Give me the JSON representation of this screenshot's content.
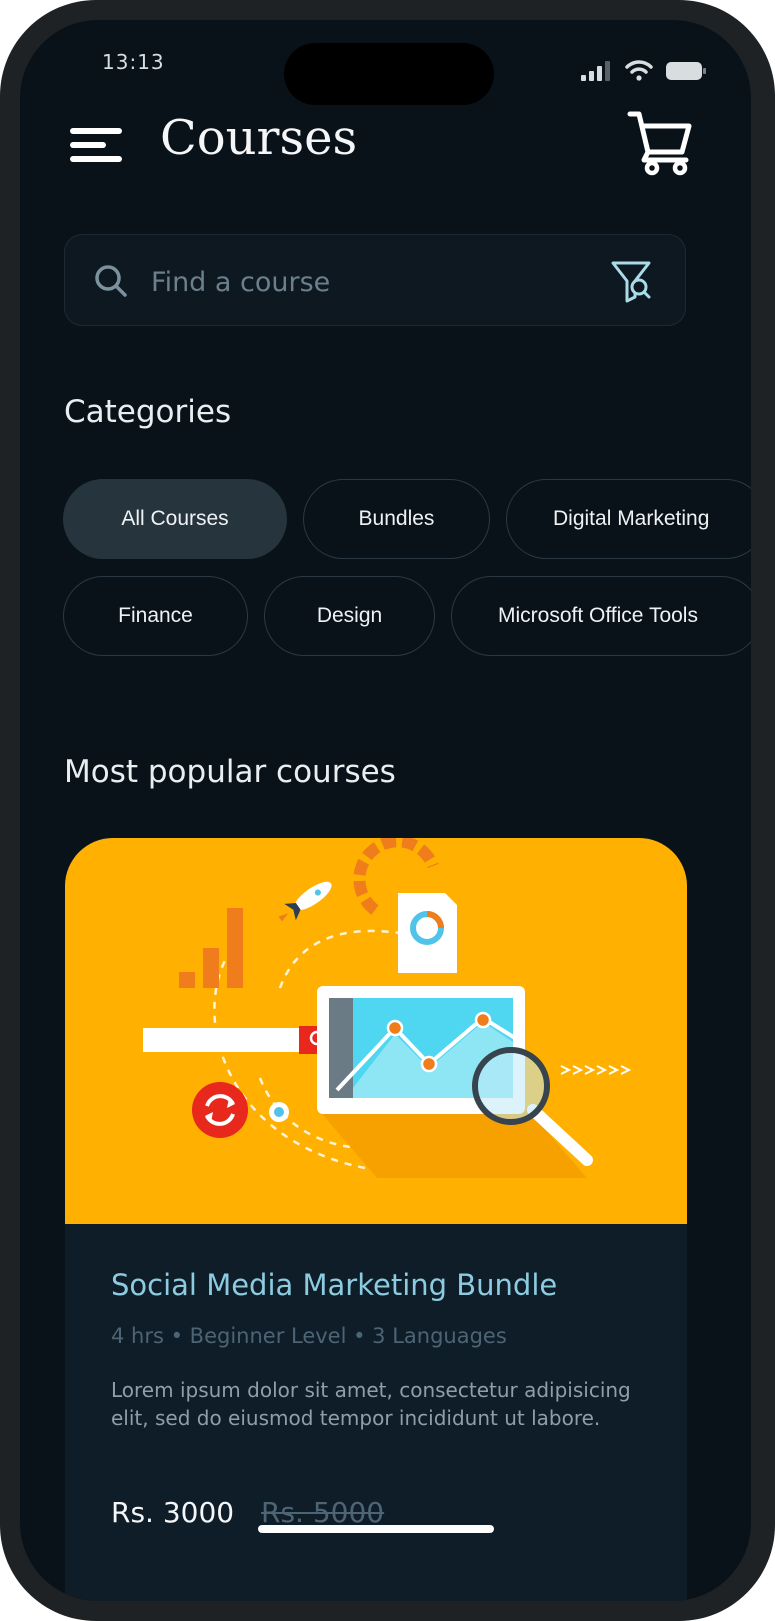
{
  "status_bar": {
    "time": "13:13"
  },
  "header": {
    "title": "Courses"
  },
  "search": {
    "placeholder": "Find a course",
    "value": ""
  },
  "categories": {
    "heading": "Categories",
    "chips": [
      {
        "label": "All Courses",
        "selected": true
      },
      {
        "label": "Bundles",
        "selected": false
      },
      {
        "label": "Digital Marketing",
        "selected": false
      },
      {
        "label": "Finance",
        "selected": false
      },
      {
        "label": "Design",
        "selected": false
      },
      {
        "label": "Microsoft Office Tools",
        "selected": false
      }
    ]
  },
  "popular": {
    "heading": "Most popular courses",
    "course": {
      "title": "Social Media Marketing Bundle",
      "meta": "4 hrs • Beginner Level • 3 Languages",
      "description": "Lorem ipsum dolor sit amet, consectetur adipisicing elit, sed do eiusmod tempor incididunt ut labore.",
      "price": "Rs. 3000",
      "old_price": "Rs. 5000"
    }
  },
  "icons": {
    "menu": "menu-icon",
    "cart": "cart-icon",
    "search": "search-icon",
    "filter": "filter-icon"
  },
  "colors": {
    "background": "#0a1219",
    "accent_text": "#8ccbe0",
    "card_image_bg": "#ffb000",
    "chip_active": "#26343e"
  }
}
